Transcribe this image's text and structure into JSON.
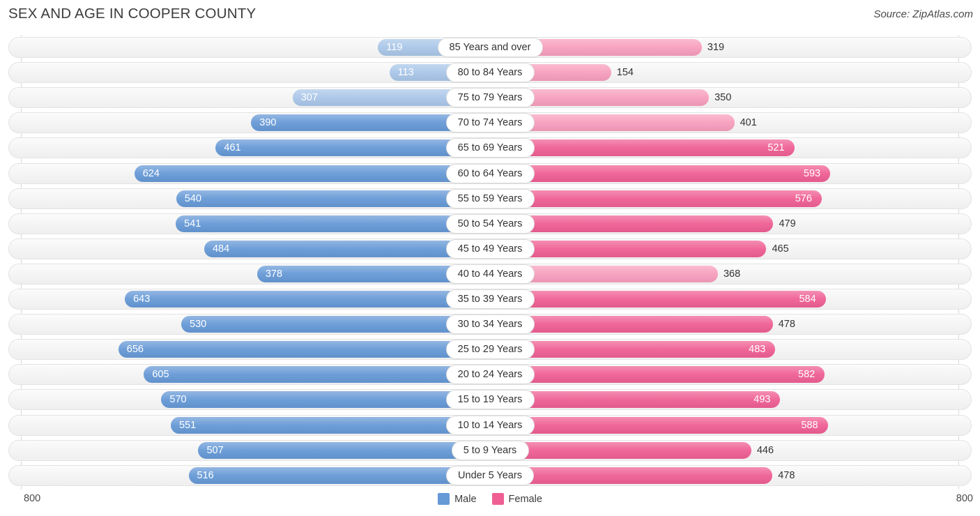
{
  "header": {
    "title": "SEX AND AGE IN COOPER COUNTY",
    "source": "Source: ZipAtlas.com"
  },
  "axis": {
    "left_max_label": "800",
    "right_max_label": "800",
    "max": 800
  },
  "legend": {
    "items": [
      {
        "label": "Male",
        "color": "#6699d6"
      },
      {
        "label": "Female",
        "color": "#f2böö"
      }
    ]
  },
  "colors": {
    "male": "#6699d6",
    "female": "#ef5f93",
    "male_light": "#a9c6e8",
    "female_light": "#f79ebd",
    "track": "#f4f4f4",
    "text_dark": "#333333",
    "text_light": "#ffffff"
  },
  "chart_data": {
    "type": "bar",
    "title": "SEX AND AGE IN COOPER COUNTY",
    "subtitle": "",
    "xlabel": "",
    "ylabel": "",
    "orientation": "horizontal",
    "style": "population-pyramid",
    "xlim": [
      0,
      800
    ],
    "grid": false,
    "legend_position": "bottom-center",
    "categories": [
      "85 Years and over",
      "80 to 84 Years",
      "75 to 79 Years",
      "70 to 74 Years",
      "65 to 69 Years",
      "60 to 64 Years",
      "55 to 59 Years",
      "50 to 54 Years",
      "45 to 49 Years",
      "40 to 44 Years",
      "35 to 39 Years",
      "30 to 34 Years",
      "25 to 29 Years",
      "20 to 24 Years",
      "15 to 19 Years",
      "10 to 14 Years",
      "5 to 9 Years",
      "Under 5 Years"
    ],
    "series": [
      {
        "name": "Male",
        "color": "#6699d6",
        "side": "left",
        "values": [
          119,
          113,
          307,
          390,
          461,
          624,
          540,
          541,
          484,
          378,
          643,
          530,
          656,
          605,
          570,
          551,
          507,
          516
        ]
      },
      {
        "name": "Female",
        "color": "#ef5f93",
        "side": "right",
        "values": [
          319,
          154,
          350,
          401,
          521,
          593,
          576,
          479,
          465,
          368,
          584,
          478,
          483,
          582,
          493,
          588,
          446,
          478
        ]
      }
    ]
  }
}
